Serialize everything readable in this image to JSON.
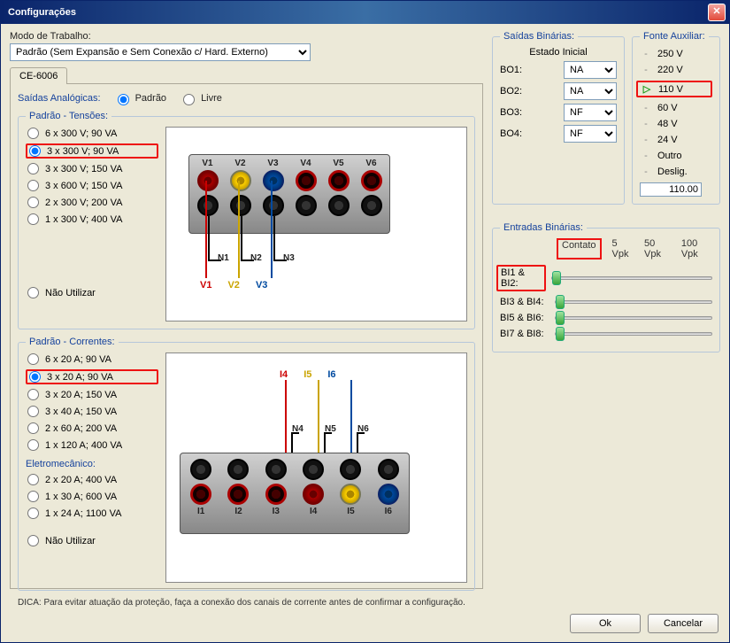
{
  "window": {
    "title": "Configurações"
  },
  "workmode": {
    "label": "Modo de Trabalho:",
    "value": "Padrão (Sem Expansão e Sem Conexão c/ Hard. Externo)"
  },
  "tabs": {
    "tab1": "CE-6006"
  },
  "analog": {
    "label": "Saídas Analógicas:",
    "opt_padrao": "Padrão",
    "opt_livre": "Livre"
  },
  "volt": {
    "legend": "Padrão - Tensões:",
    "r0": "6 x 300 V; 90 VA",
    "r1": "3 x 300 V; 90 VA",
    "r2": "3 x 300 V; 150 VA",
    "r3": "3 x 600 V; 150 VA",
    "r4": "2 x 300 V; 200 VA",
    "r5": "1 x 300 V; 400 VA",
    "r6": "Não Utilizar",
    "V1": "V1",
    "V2": "V2",
    "V3": "V3",
    "V4": "V4",
    "V5": "V5",
    "V6": "V6",
    "N1": "N1",
    "N2": "N2",
    "N3": "N3",
    "lV1": "V1",
    "lV2": "V2",
    "lV3": "V3"
  },
  "cur": {
    "legend": "Padrão - Correntes:",
    "r0": "6 x 20 A; 90 VA",
    "r1": "3 x 20 A; 90 VA",
    "r2": "3 x 20 A; 150 VA",
    "r3": "3 x 40 A; 150 VA",
    "r4": "2 x 60 A; 200 VA",
    "r5": "1 x 120 A; 400 VA",
    "em_legend": "Eletromecânico:",
    "e0": "2 x 20 A; 400 VA",
    "e1": "1 x 30 A; 600 VA",
    "e2": "1 x 24 A; 1100 VA",
    "r6": "Não Utilizar",
    "I1": "I1",
    "I2": "I2",
    "I3": "I3",
    "I4": "I4",
    "I5": "I5",
    "I6": "I6",
    "N4": "N4",
    "N5": "N5",
    "N6": "N6",
    "lI4": "I4",
    "lI5": "I5",
    "lI6": "I6"
  },
  "bo": {
    "legend": "Saídas Binárias:",
    "state_label": "Estado Inicial",
    "rows": {
      "b1": "BO1:",
      "b2": "BO2:",
      "b3": "BO3:",
      "b4": "BO4:"
    },
    "v1": "NA",
    "v2": "NA",
    "v3": "NF",
    "v4": "NF"
  },
  "aux": {
    "legend": "Fonte Auxiliar:",
    "v250": "250 V",
    "v220": "220 V",
    "v110": "110 V",
    "v60": "60 V",
    "v48": "48 V",
    "v24": "24 V",
    "vOutro": "Outro",
    "vDeslig": "Deslig.",
    "input": "110.00"
  },
  "bi": {
    "legend": "Entradas Binárias:",
    "h0": "Contato",
    "h1": "5 Vpk",
    "h2": "50 Vpk",
    "h3": "100 Vpk",
    "r1": "BI1 & BI2:",
    "r2": "BI3 & BI4:",
    "r3": "BI5 & BI6:",
    "r4": "BI7 & BI8:"
  },
  "hint": "DICA: Para evitar atuação da proteção, faça a conexão dos canais de corrente antes de confirmar a configuração.",
  "btn": {
    "ok": "Ok",
    "cancel": "Cancelar"
  }
}
